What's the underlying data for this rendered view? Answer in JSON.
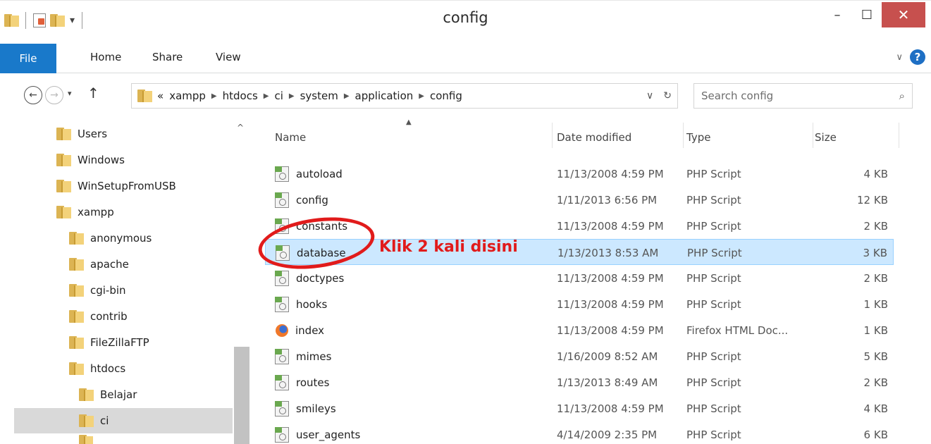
{
  "window": {
    "title": "config",
    "minimize": "–",
    "maximize": "☐",
    "close": "✕"
  },
  "ribbon": {
    "tabs": [
      "File",
      "Home",
      "Share",
      "View"
    ]
  },
  "navigation": {
    "back": "←",
    "forward": "→",
    "recent": "▾",
    "up": "↑",
    "overflow": "«",
    "breadcrumbs": [
      "xampp",
      "htdocs",
      "ci",
      "system",
      "application",
      "config"
    ],
    "address_dropdown": "∨",
    "refresh": "↻"
  },
  "search": {
    "placeholder": "Search config"
  },
  "tree": [
    {
      "label": "Users",
      "indent": 0
    },
    {
      "label": "Windows",
      "indent": 0
    },
    {
      "label": "WinSetupFromUSB",
      "indent": 0
    },
    {
      "label": "xampp",
      "indent": 0
    },
    {
      "label": "anonymous",
      "indent": 1
    },
    {
      "label": "apache",
      "indent": 1
    },
    {
      "label": "cgi-bin",
      "indent": 1
    },
    {
      "label": "contrib",
      "indent": 1
    },
    {
      "label": "FileZillaFTP",
      "indent": 1
    },
    {
      "label": "htdocs",
      "indent": 1
    },
    {
      "label": "Belajar",
      "indent": 2
    },
    {
      "label": "ci",
      "indent": 2,
      "selected": true
    }
  ],
  "columns": {
    "name": "Name",
    "date": "Date modified",
    "type": "Type",
    "size": "Size"
  },
  "files": [
    {
      "name": "autoload",
      "date": "11/13/2008 4:59 PM",
      "type": "PHP Script",
      "size": "4 KB",
      "icon": "php-script-icon"
    },
    {
      "name": "config",
      "date": "1/11/2013 6:56 PM",
      "type": "PHP Script",
      "size": "12 KB",
      "icon": "php-script-icon"
    },
    {
      "name": "constants",
      "date": "11/13/2008 4:59 PM",
      "type": "PHP Script",
      "size": "2 KB",
      "icon": "php-script-icon"
    },
    {
      "name": "database",
      "date": "1/13/2013 8:53 AM",
      "type": "PHP Script",
      "size": "3 KB",
      "icon": "php-script-icon",
      "selected": true
    },
    {
      "name": "doctypes",
      "date": "11/13/2008 4:59 PM",
      "type": "PHP Script",
      "size": "2 KB",
      "icon": "php-script-icon"
    },
    {
      "name": "hooks",
      "date": "11/13/2008 4:59 PM",
      "type": "PHP Script",
      "size": "1 KB",
      "icon": "php-script-icon"
    },
    {
      "name": "index",
      "date": "11/13/2008 4:59 PM",
      "type": "Firefox HTML Doc...",
      "size": "1 KB",
      "icon": "firefox-icon"
    },
    {
      "name": "mimes",
      "date": "1/16/2009 8:52 AM",
      "type": "PHP Script",
      "size": "5 KB",
      "icon": "php-script-icon"
    },
    {
      "name": "routes",
      "date": "1/13/2013 8:49 AM",
      "type": "PHP Script",
      "size": "2 KB",
      "icon": "php-script-icon"
    },
    {
      "name": "smileys",
      "date": "11/13/2008 4:59 PM",
      "type": "PHP Script",
      "size": "4 KB",
      "icon": "php-script-icon"
    },
    {
      "name": "user_agents",
      "date": "4/14/2009 2:35 PM",
      "type": "PHP Script",
      "size": "6 KB",
      "icon": "php-script-icon"
    }
  ],
  "annotation": {
    "text": "Klik 2 kali disini",
    "color": "#e11b1b"
  },
  "colors": {
    "accent": "#1979ca",
    "selection": "#cce8ff",
    "close": "#c7504e"
  }
}
